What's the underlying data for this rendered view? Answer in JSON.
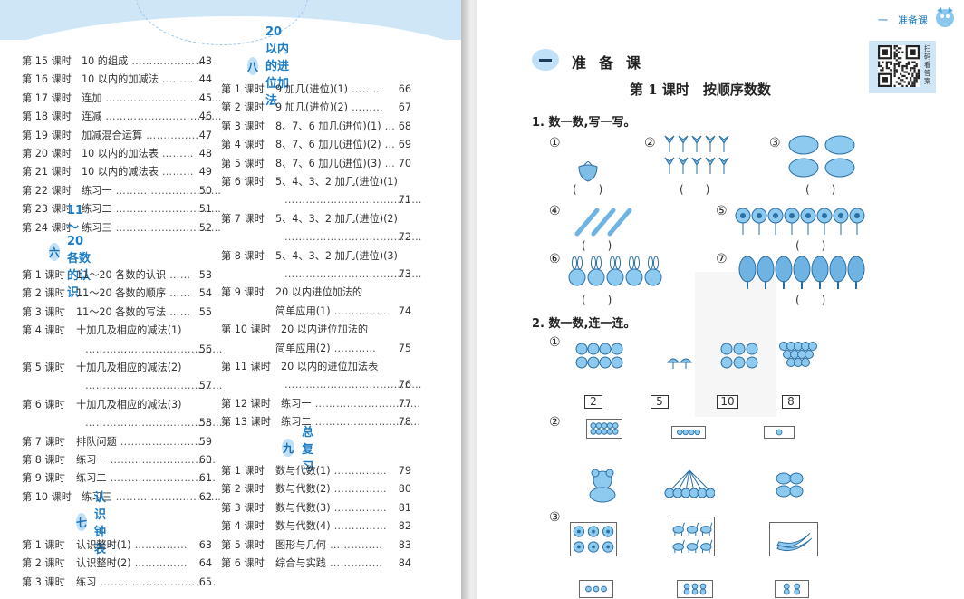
{
  "left_page": {
    "col1_top": [
      {
        "lesson": "第 15 课时",
        "title": "10 的组成",
        "dots": "…………………",
        "page": "43"
      },
      {
        "lesson": "第 16 课时",
        "title": "10 以内的加减法",
        "dots": "………",
        "page": "44"
      },
      {
        "lesson": "第 17 课时",
        "title": "连加",
        "dots": "……………………………",
        "page": "45"
      },
      {
        "lesson": "第 18 课时",
        "title": "连减",
        "dots": "……………………………",
        "page": "46"
      },
      {
        "lesson": "第 19 课时",
        "title": "加减混合运算",
        "dots": "……………",
        "page": "47"
      },
      {
        "lesson": "第 20 课时",
        "title": "10 以内的加法表",
        "dots": "………",
        "page": "48"
      },
      {
        "lesson": "第 21 课时",
        "title": "10 以内的减法表",
        "dots": "………",
        "page": "49"
      },
      {
        "lesson": "第 22 课时",
        "title": "练习一",
        "dots": "…………………………",
        "page": "50"
      },
      {
        "lesson": "第 23 课时",
        "title": "练习二",
        "dots": "…………………………",
        "page": "51"
      },
      {
        "lesson": "第 24 课时",
        "title": "练习三",
        "dots": "…………………………",
        "page": "52"
      }
    ],
    "unit6": {
      "num": "六",
      "name": "11～20 各数的认识"
    },
    "unit6_rows": [
      {
        "lesson": "第 1 课时",
        "title": "11～20 各数的认识",
        "dots": "……",
        "page": "53"
      },
      {
        "lesson": "第 2 课时",
        "title": "11～20 各数的顺序",
        "dots": "……",
        "page": "54"
      },
      {
        "lesson": "第 3 课时",
        "title": "11～20 各数的写法",
        "dots": "……",
        "page": "55"
      },
      {
        "lesson": "第 4 课时",
        "title": "十加几及相应的减法(1)",
        "dots": "",
        "page": ""
      },
      {
        "lesson": "",
        "title": "",
        "dots": "…………………………………",
        "page": "56"
      },
      {
        "lesson": "第 5 课时",
        "title": "十加几及相应的减法(2)",
        "dots": "",
        "page": ""
      },
      {
        "lesson": "",
        "title": "",
        "dots": "…………………………………",
        "page": "57"
      },
      {
        "lesson": "第 6 课时",
        "title": "十加几及相应的减法(3)",
        "dots": "",
        "page": ""
      },
      {
        "lesson": "",
        "title": "",
        "dots": "…………………………………",
        "page": "58"
      },
      {
        "lesson": "第 7 课时",
        "title": "排队问题",
        "dots": "……………………",
        "page": "59"
      },
      {
        "lesson": "第 8 课时",
        "title": "练习一",
        "dots": "…………………………",
        "page": "60"
      },
      {
        "lesson": "第 9 课时",
        "title": "练习二",
        "dots": "…………………………",
        "page": "61"
      },
      {
        "lesson": "第 10 课时",
        "title": "练习三",
        "dots": "…………………………",
        "page": "62"
      }
    ],
    "unit7": {
      "num": "七",
      "name": "认识钟表"
    },
    "unit7_rows": [
      {
        "lesson": "第 1 课时",
        "title": "认识整时(1)",
        "dots": "……………",
        "page": "63"
      },
      {
        "lesson": "第 2 课时",
        "title": "认识整时(2)",
        "dots": "……………",
        "page": "64"
      },
      {
        "lesson": "第 3 课时",
        "title": "练习",
        "dots": "……………………………",
        "page": "65"
      }
    ],
    "unit8": {
      "num": "八",
      "name": "20 以内的进位加法"
    },
    "unit8_rows": [
      {
        "lesson": "第 1 课时",
        "title": "9 加几(进位)(1)",
        "dots": "………",
        "page": "66"
      },
      {
        "lesson": "第 2 课时",
        "title": "9 加几(进位)(2)",
        "dots": "………",
        "page": "67"
      },
      {
        "lesson": "第 3 课时",
        "title": "8、7、6 加几(进位)(1)",
        "dots": "…",
        "page": "68"
      },
      {
        "lesson": "第 4 课时",
        "title": "8、7、6 加几(进位)(2)",
        "dots": "…",
        "page": "69"
      },
      {
        "lesson": "第 5 课时",
        "title": "8、7、6 加几(进位)(3)",
        "dots": "…",
        "page": "70"
      },
      {
        "lesson": "第 6 课时",
        "title": "5、4、3、2 加几(进位)(1)",
        "dots": "",
        "page": ""
      },
      {
        "lesson": "",
        "title": "",
        "dots": "…………………………………",
        "page": "71"
      },
      {
        "lesson": "第 7 课时",
        "title": "5、4、3、2 加几(进位)(2)",
        "dots": "",
        "page": ""
      },
      {
        "lesson": "",
        "title": "",
        "dots": "…………………………………",
        "page": "72"
      },
      {
        "lesson": "第 8 课时",
        "title": "5、4、3、2 加几(进位)(3)",
        "dots": "",
        "page": ""
      },
      {
        "lesson": "",
        "title": "",
        "dots": "…………………………………",
        "page": "73"
      },
      {
        "lesson": "第 9 课时",
        "title": "20 以内进位加法的",
        "dots": "",
        "page": ""
      },
      {
        "lesson": "",
        "title": "简单应用(1)",
        "dots": "……………",
        "page": "74"
      },
      {
        "lesson": "第 10 课时",
        "title": "20 以内进位加法的",
        "dots": "",
        "page": ""
      },
      {
        "lesson": "",
        "title": "简单应用(2)",
        "dots": "…………",
        "page": "75"
      },
      {
        "lesson": "第 11 课时",
        "title": "20 以内的进位加法表",
        "dots": "",
        "page": ""
      },
      {
        "lesson": "",
        "title": "",
        "dots": "…………………………………",
        "page": "76"
      },
      {
        "lesson": "第 12 课时",
        "title": "练习一",
        "dots": "…………………………",
        "page": "77"
      },
      {
        "lesson": "第 13 课时",
        "title": "练习二",
        "dots": "…………………………",
        "page": "78"
      }
    ],
    "unit9": {
      "num": "九",
      "name": "总复习"
    },
    "unit9_rows": [
      {
        "lesson": "第 1 课时",
        "title": "数与代数(1)",
        "dots": "……………",
        "page": "79"
      },
      {
        "lesson": "第 2 课时",
        "title": "数与代数(2)",
        "dots": "……………",
        "page": "80"
      },
      {
        "lesson": "第 3 课时",
        "title": "数与代数(3)",
        "dots": "……………",
        "page": "81"
      },
      {
        "lesson": "第 4 课时",
        "title": "数与代数(4)",
        "dots": "……………",
        "page": "82"
      },
      {
        "lesson": "第 5 课时",
        "title": "图形与几何",
        "dots": "……………",
        "page": "83"
      },
      {
        "lesson": "第 6 课时",
        "title": "综合与实践",
        "dots": "……………",
        "page": "84"
      }
    ]
  },
  "right_page": {
    "running_head": "一　准备课",
    "qr_label": "扫码看答案",
    "unit_name": "准备课",
    "lesson_title": "第 1 课时　按顺序数数",
    "q1": "1. 数一数,写一写。",
    "q2": "2. 数一数,连一连。",
    "circled": [
      "①",
      "②",
      "③",
      "④",
      "⑤",
      "⑥",
      "⑦"
    ],
    "paren": "(　　)",
    "q2_numbers": [
      "2",
      "5",
      "10",
      "8"
    ],
    "icons": [
      "strawberry-icon",
      "flower-icon",
      "elephant-icon",
      "pencil-icon",
      "sunflower-icon",
      "rabbit-icon",
      "tree-icon",
      "apple-icon",
      "mushroom-icon",
      "bear-icon",
      "cherry-icon",
      "fish-icon",
      "deer-icon",
      "banana-icon"
    ]
  },
  "colors": {
    "accent_blue": "#1b7cc7",
    "badge_blue": "#bfe0f6",
    "light_band": "#cfe6f7",
    "picture_blue": "#4fa7dc"
  }
}
